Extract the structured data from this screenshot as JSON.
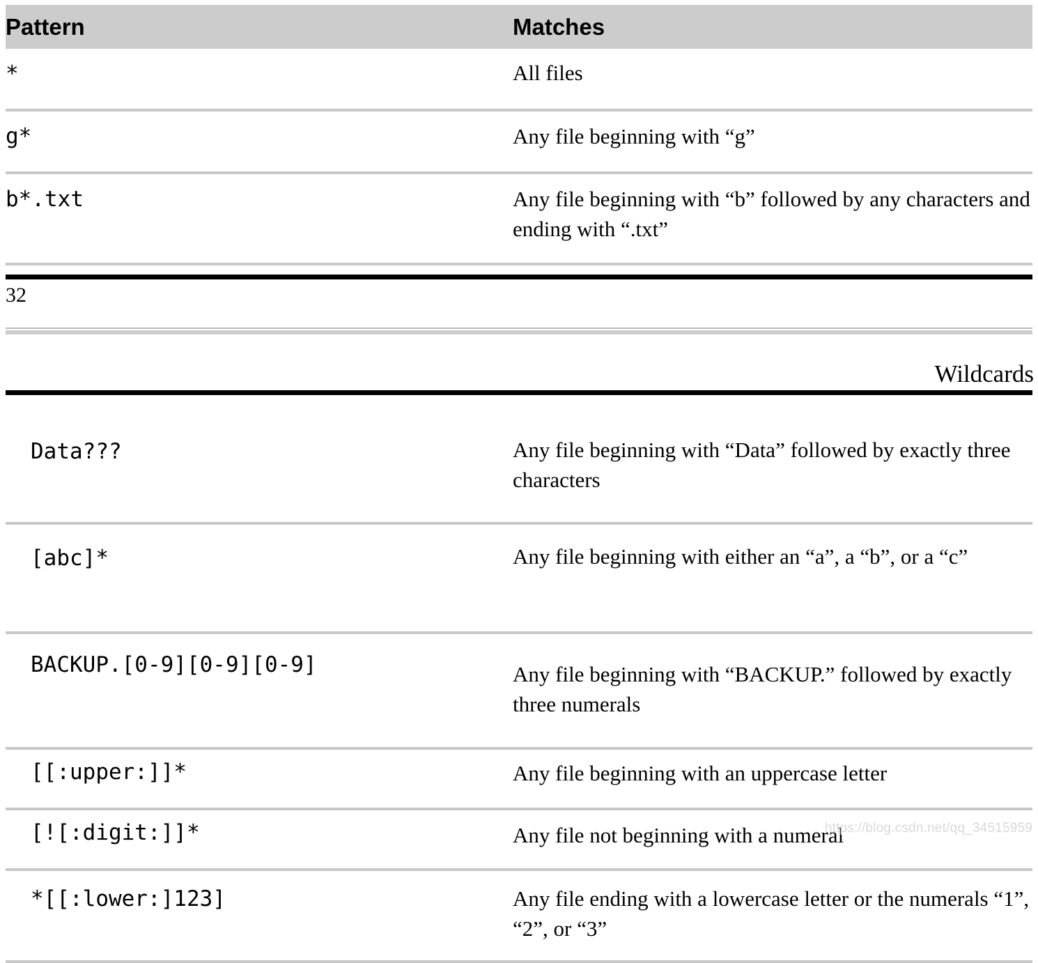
{
  "document": {
    "page_number": "32",
    "running_head": "Wildcards",
    "watermark": "https://blog.csdn.net/qq_34515959"
  },
  "table_top": {
    "headers": {
      "pattern": "Pattern",
      "matches": "Matches"
    },
    "rows": [
      {
        "pattern": "*",
        "matches": "All files"
      },
      {
        "pattern": "g*",
        "matches": "Any file beginning with “g”"
      },
      {
        "pattern": "b*.txt",
        "matches": "Any file beginning with “b” followed by any characters and ending with “.txt”"
      }
    ]
  },
  "table_bottom": {
    "rows": [
      {
        "pattern": "Data???",
        "matches": "Any file beginning with “Data” followed by exactly three characters"
      },
      {
        "pattern": "[abc]*",
        "matches": "Any file beginning with either an “a”, a “b”, or a “c”"
      },
      {
        "pattern": "BACKUP.[0-9][0-9][0-9]",
        "matches": "Any file beginning with “BACKUP.” followed by exactly three numerals"
      },
      {
        "pattern": "[[:upper:]]*",
        "matches": "Any file beginning with an uppercase letter"
      },
      {
        "pattern": "[![:digit:]]*",
        "matches": "Any file not beginning with a numeral"
      },
      {
        "pattern": "*[[:lower:]123]",
        "matches": "Any file ending with a lowercase letter or the numerals “1”, “2”, or “3”"
      }
    ]
  },
  "colors": {
    "header_background": "#cccccc",
    "row_rule": "#c8c8c8",
    "page_rule": "#000000",
    "watermark": "#d9d9d9"
  }
}
